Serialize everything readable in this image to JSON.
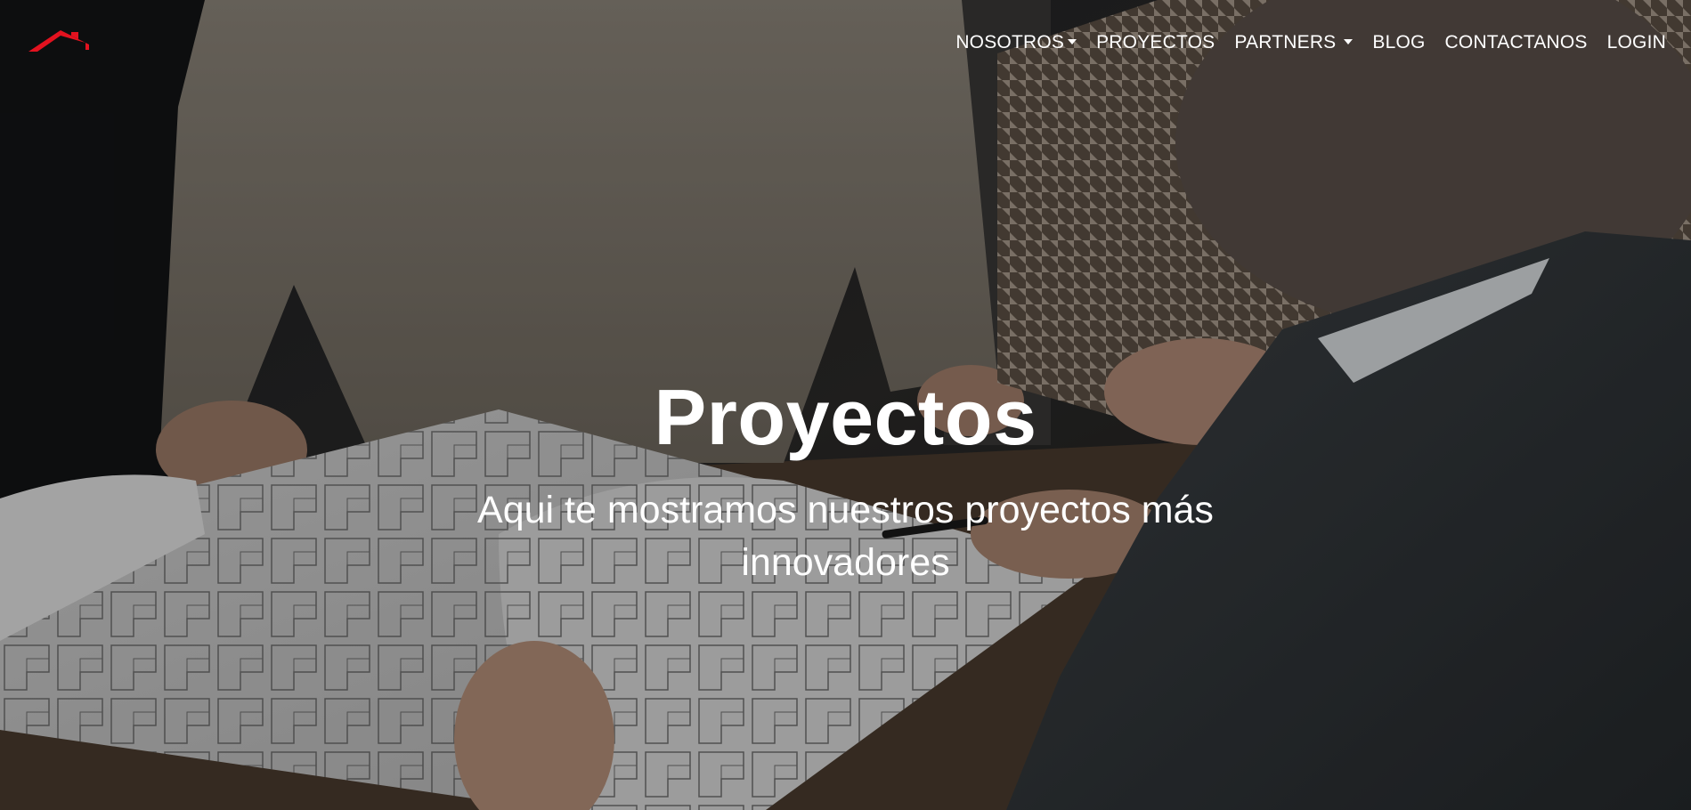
{
  "brand": {
    "logo_icon": "roof-icon",
    "accent_color": "#e3121f"
  },
  "nav": {
    "items": [
      {
        "label": "NOSOTROS",
        "dropdown": true
      },
      {
        "label": "PROYECTOS",
        "dropdown": false
      },
      {
        "label": "PARTNERS",
        "dropdown": true
      },
      {
        "label": "BLOG",
        "dropdown": false
      },
      {
        "label": "CONTACTANOS",
        "dropdown": false
      },
      {
        "label": "LOGIN",
        "dropdown": false
      }
    ]
  },
  "hero": {
    "title": "Proyectos",
    "subtitle": "Aqui te mostramos nuestros proyectos más innovadores"
  }
}
